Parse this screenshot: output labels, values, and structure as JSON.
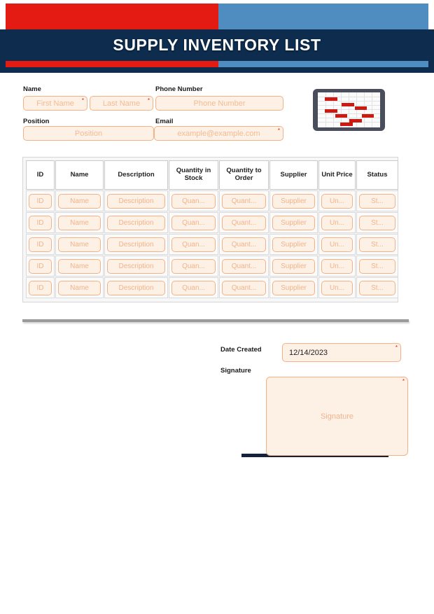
{
  "banner": {
    "title": "SUPPLY INVENTORY LIST",
    "red": "#e31b13",
    "blue": "#4f8cc0",
    "navy": "#0d2c4e"
  },
  "icons": {
    "tablet": "tablet-spreadsheet-icon",
    "required": "*"
  },
  "form": {
    "name_label": "Name",
    "first_name_placeholder": "First Name",
    "last_name_placeholder": "Last Name",
    "phone_label": "Phone Number",
    "phone_placeholder": "Phone Number",
    "position_label": "Position",
    "position_placeholder": "Position",
    "email_label": "Email",
    "email_placeholder": "example@example.com"
  },
  "table": {
    "headers": [
      "ID",
      "Name",
      "Description",
      "Quantity in Stock",
      "Quantity to Order",
      "Supplier",
      "Unit Price",
      "Status"
    ],
    "row_placeholders": [
      "ID",
      "Name",
      "Description",
      "Quan...",
      "Quant...",
      "Supplier",
      "Un...",
      "St..."
    ],
    "row_count": 5
  },
  "footer": {
    "date_label": "Date Created",
    "date_value": "12/14/2023",
    "signature_label": "Signature",
    "signature_placeholder": "Signature"
  },
  "theme": {
    "field_fill": "#fdf0e4",
    "field_border": "#f5b183",
    "placeholder_text": "#f0b48f",
    "required_mark": "#e31b13"
  }
}
